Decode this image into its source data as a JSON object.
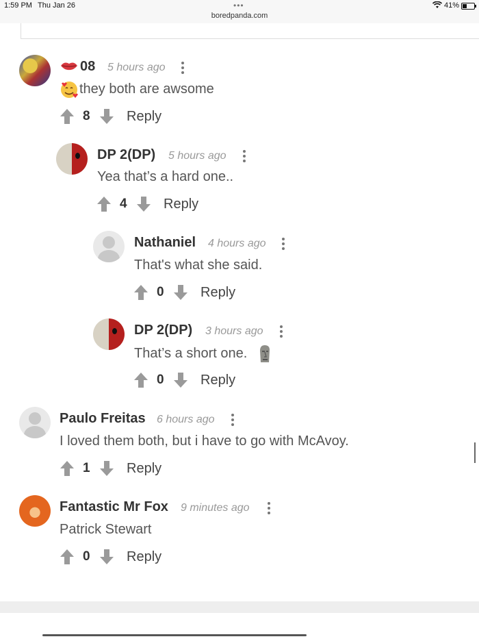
{
  "status_bar": {
    "time": "1:59 PM",
    "date": "Thu Jan 26",
    "url": "boredpanda.com",
    "battery": "41%"
  },
  "comments": [
    {
      "name": "08",
      "time": "5 hours ago",
      "text": "they both are awsome",
      "score": "8",
      "reply": "Reply",
      "avatar": "xmen-avatar"
    },
    {
      "name": "DP 2(DP)",
      "time": "5 hours ago",
      "text": "Yea that’s a hard one..",
      "score": "4",
      "reply": "Reply",
      "avatar": "deadpool-avatar"
    },
    {
      "name": "Nathaniel",
      "time": "4 hours ago",
      "text": "That's what she said.",
      "score": "0",
      "reply": "Reply",
      "avatar": "default-avatar"
    },
    {
      "name": "DP 2(DP)",
      "time": "3 hours ago",
      "text": "That’s a short one.",
      "score": "0",
      "reply": "Reply",
      "avatar": "deadpool-avatar"
    },
    {
      "name": "Paulo Freitas",
      "time": "6 hours ago",
      "text": "I loved them both, but i have to go with McAvoy.",
      "score": "1",
      "reply": "Reply",
      "avatar": "default-avatar"
    },
    {
      "name": "Fantastic Mr Fox",
      "time": "9 minutes ago",
      "text": "Patrick Stewart",
      "score": "0",
      "reply": "Reply",
      "avatar": "fox-avatar"
    }
  ],
  "icons": {
    "upvote": "arrow-up-icon",
    "downvote": "arrow-down-icon",
    "menu": "kebab-menu-icon",
    "lips": "lips-emoji-icon",
    "heart_face": "smiling-face-with-hearts-emoji-icon",
    "moai": "moai-emoji-icon"
  },
  "colors": {
    "arrow": "#9a9a9a",
    "name": "#333333",
    "time": "#999999",
    "text": "#555555"
  }
}
